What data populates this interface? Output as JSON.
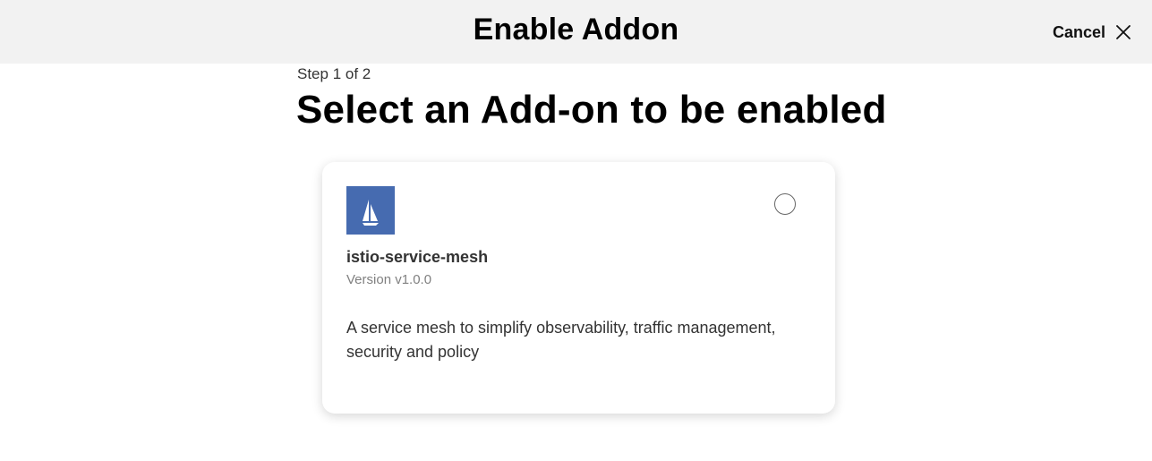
{
  "header": {
    "title": "Enable Addon",
    "cancel_label": "Cancel",
    "cancel_icon": "close-icon"
  },
  "wizard": {
    "step_label": "Step 1 of 2",
    "title": "Select an Add-on to be enabled"
  },
  "addons": [
    {
      "name": "istio-service-mesh",
      "version": "Version v1.0.0",
      "description": "A service mesh to simplify observability, traffic management, security and policy",
      "logo_icon": "sailboat-icon",
      "logo_color": "#466bb0",
      "selected": false
    }
  ]
}
